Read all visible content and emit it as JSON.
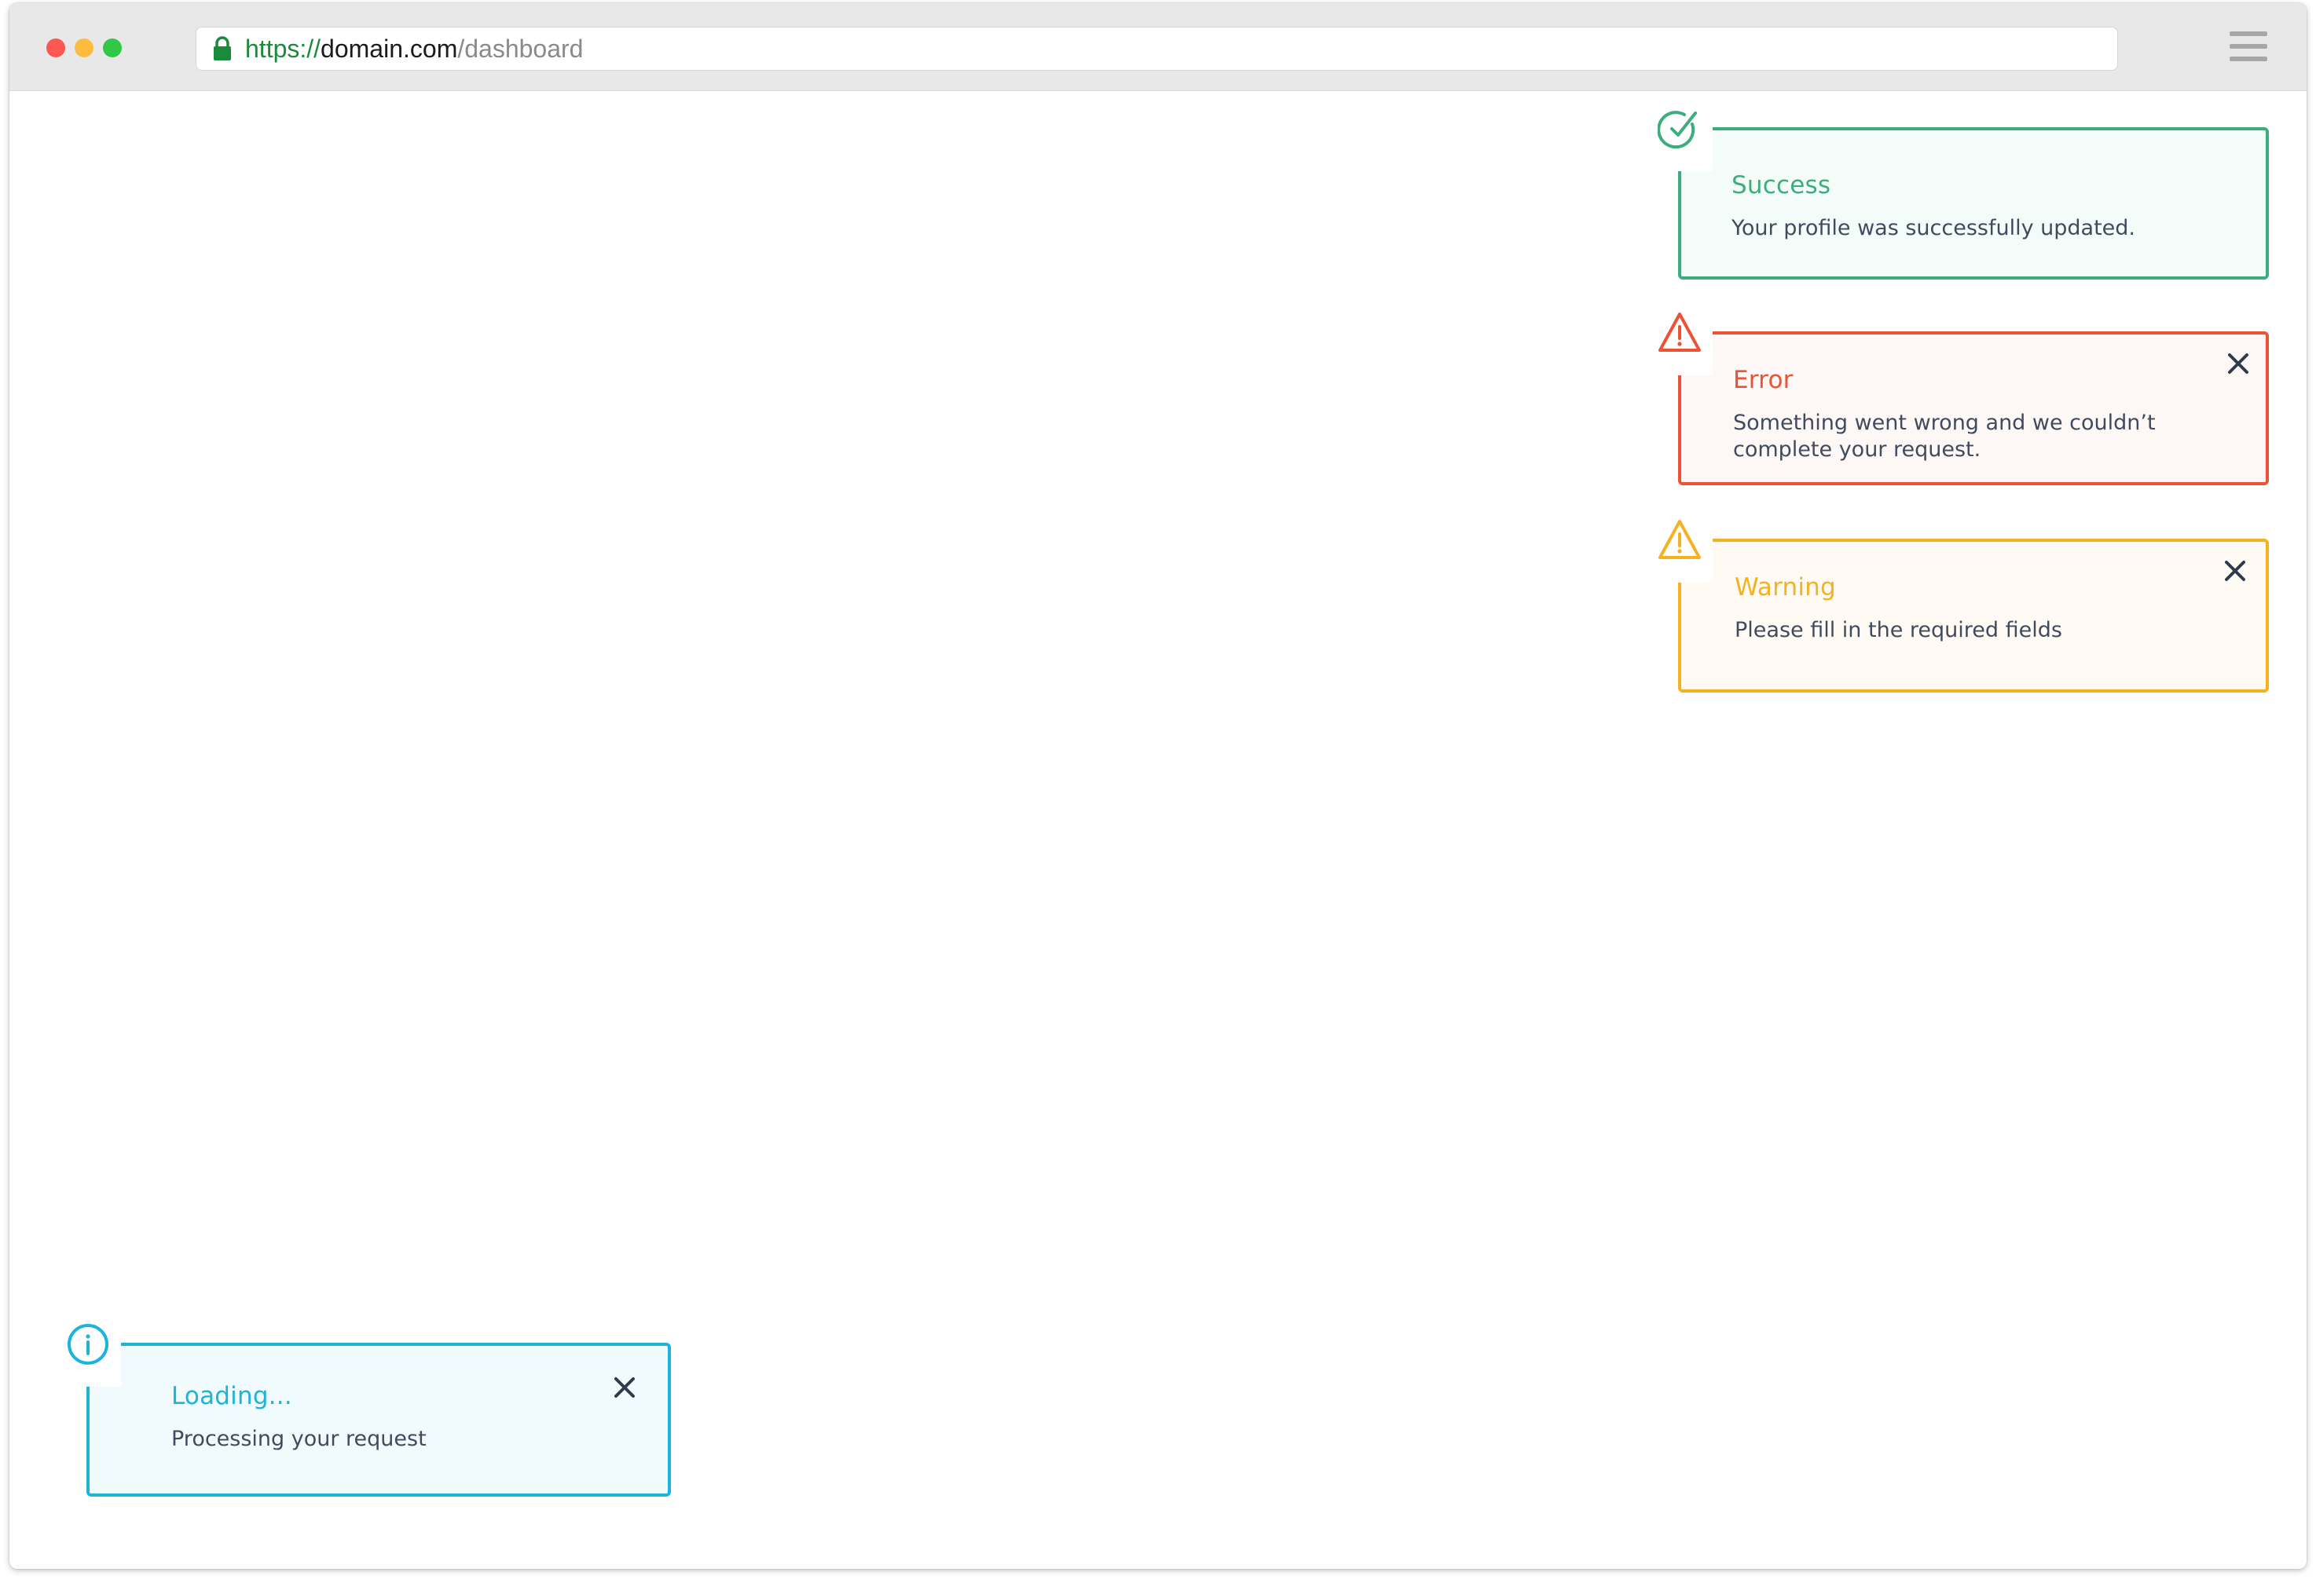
{
  "browser": {
    "url_scheme": "https://",
    "url_host": "domain.com",
    "url_path": "/dashboard"
  },
  "toasts": {
    "success": {
      "title": "Success",
      "message": "Your profile was successfully updated.",
      "color": "#3dad7e",
      "icon": "check-circle-icon"
    },
    "error": {
      "title": "Error",
      "message": "Something went wrong and we couldn’t complete your request.",
      "color": "#ec5236",
      "icon": "alert-triangle-icon"
    },
    "warning": {
      "title": "Warning",
      "message": "Please fill in the required fields",
      "color": "#f5b120",
      "icon": "alert-triangle-icon"
    },
    "info": {
      "title": "Loading...",
      "message": "Processing your request",
      "color": "#1cb4d8",
      "icon": "info-circle-icon"
    }
  }
}
